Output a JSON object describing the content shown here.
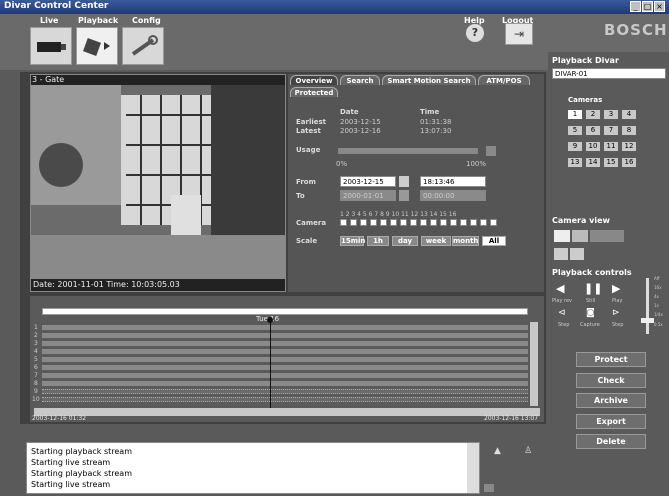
{
  "window": {
    "title": "Divar Control Center",
    "controls": [
      "_",
      "□",
      "×"
    ]
  },
  "menu": {
    "live": "Live",
    "playback": "Playback",
    "config": "Config",
    "help": "Help",
    "logout": "Logout",
    "help_glyph": "?",
    "logout_glyph": "⇥"
  },
  "brand": "BOSCH",
  "camera_view": {
    "label": "3 - Gate",
    "timestamp": "Date: 2001-11-01  Time: 10:03:05.03"
  },
  "tabs": [
    "Overview",
    "Search",
    "Smart Motion Search",
    "ATM/POS",
    "Protected"
  ],
  "overview": {
    "date_header": "Date",
    "time_header": "Time",
    "earliest_label": "Earliest",
    "earliest_date": "2003-12-15",
    "earliest_time": "01:31:38",
    "latest_label": "Latest",
    "latest_date": "2003-12-16",
    "latest_time": "13:07:30",
    "usage_label": "Usage",
    "usage_min": "0%",
    "usage_max": "100%",
    "from_label": "From",
    "from_date": "2003-12-15",
    "from_time": "18:13:46",
    "to_label": "To",
    "to_date": "2000-01-01",
    "to_time": "00:00:00",
    "camera_label": "Camera",
    "camera_numbers": "1  2  3  4  5  6  7  8  9 10 11 12 13 14 15 16",
    "scale_label": "Scale",
    "scale_options": [
      "15min",
      "1h",
      "day",
      "week",
      "month",
      "All"
    ],
    "scale_selected": "All"
  },
  "timeline": {
    "day_label": "Tue 16",
    "start": "2003-12-16 01:32",
    "end": "2003-12-16 13:07",
    "rows": [
      "1",
      "2",
      "3",
      "4",
      "5",
      "6",
      "7",
      "8",
      "9",
      "10"
    ]
  },
  "playback_divar": {
    "title": "Playback Divar",
    "selected": "DIVAR-01"
  },
  "cameras": {
    "title": "Cameras",
    "buttons": [
      "1",
      "2",
      "3",
      "4",
      "5",
      "6",
      "7",
      "8",
      "9",
      "10",
      "11",
      "12",
      "13",
      "14",
      "15",
      "16"
    ],
    "selected": "1"
  },
  "camera_view_panel": {
    "title": "Camera view"
  },
  "playback_controls": {
    "title": "Playback controls",
    "labels": [
      "Play rev",
      "Still",
      "Play",
      "Step",
      "Capture",
      "Step"
    ],
    "speeds": [
      "Aff",
      "16x",
      "4x",
      "1x",
      "1/4x",
      "0.5x"
    ]
  },
  "actions": [
    "Protect",
    "Check",
    "Archive",
    "Export",
    "Delete"
  ],
  "log": [
    "Starting playback stream",
    "Starting live stream",
    "Starting playback stream",
    "Starting live stream"
  ]
}
